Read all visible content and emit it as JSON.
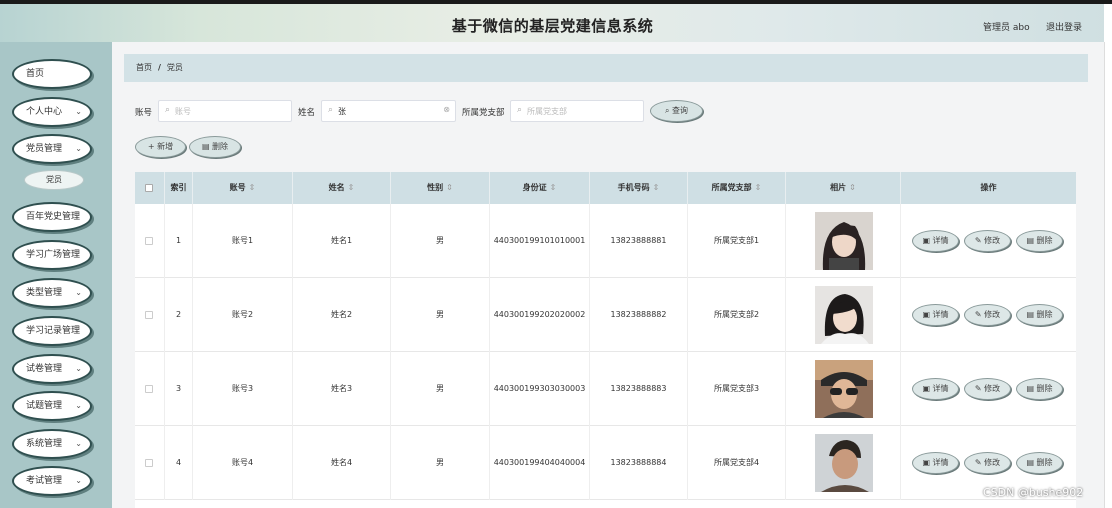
{
  "header": {
    "title": "基于微信的基层党建信息系统",
    "admin_label": "管理员 abo",
    "logout_label": "退出登录"
  },
  "sidebar": {
    "items": [
      {
        "label": "首页",
        "has_chevron": false
      },
      {
        "label": "个人中心",
        "has_chevron": true
      },
      {
        "label": "党员管理",
        "has_chevron": true
      },
      {
        "label": "百年党史管理",
        "has_chevron": false
      },
      {
        "label": "学习广场管理",
        "has_chevron": false
      },
      {
        "label": "类型管理",
        "has_chevron": true
      },
      {
        "label": "学习记录管理",
        "has_chevron": false
      },
      {
        "label": "试卷管理",
        "has_chevron": true
      },
      {
        "label": "试题管理",
        "has_chevron": true
      },
      {
        "label": "系统管理",
        "has_chevron": true
      },
      {
        "label": "考试管理",
        "has_chevron": true
      }
    ],
    "sub_item": "党员"
  },
  "breadcrumb": {
    "home": "首页",
    "separator": "/",
    "current": "党员"
  },
  "search": {
    "account_label": "账号",
    "account_placeholder": "账号",
    "account_value": "",
    "name_label": "姓名",
    "name_placeholder": "姓名",
    "name_value": "张",
    "branch_label": "所属党支部",
    "branch_placeholder": "所属党支部",
    "query_button": "查询"
  },
  "actions": {
    "add_button": "新增",
    "delete_button": "删除"
  },
  "table": {
    "columns": [
      "索引",
      "账号",
      "姓名",
      "性别",
      "身份证",
      "手机号码",
      "所属党支部",
      "相片",
      "操作"
    ],
    "rows": [
      {
        "index": "1",
        "account": "账号1",
        "name": "姓名1",
        "gender": "男",
        "id_card": "440300199101010001",
        "phone": "13823888881",
        "branch": "所属党支部1"
      },
      {
        "index": "2",
        "account": "账号2",
        "name": "姓名2",
        "gender": "男",
        "id_card": "440300199202020002",
        "phone": "13823888882",
        "branch": "所属党支部2"
      },
      {
        "index": "3",
        "account": "账号3",
        "name": "姓名3",
        "gender": "男",
        "id_card": "440300199303030003",
        "phone": "13823888883",
        "branch": "所属党支部3"
      },
      {
        "index": "4",
        "account": "账号4",
        "name": "姓名4",
        "gender": "男",
        "id_card": "440300199404040004",
        "phone": "13823888884",
        "branch": "所属党支部4"
      }
    ],
    "row_actions": {
      "detail": "详情",
      "edit": "修改",
      "delete": "删除"
    }
  },
  "watermark": "CSDN @bushe902"
}
